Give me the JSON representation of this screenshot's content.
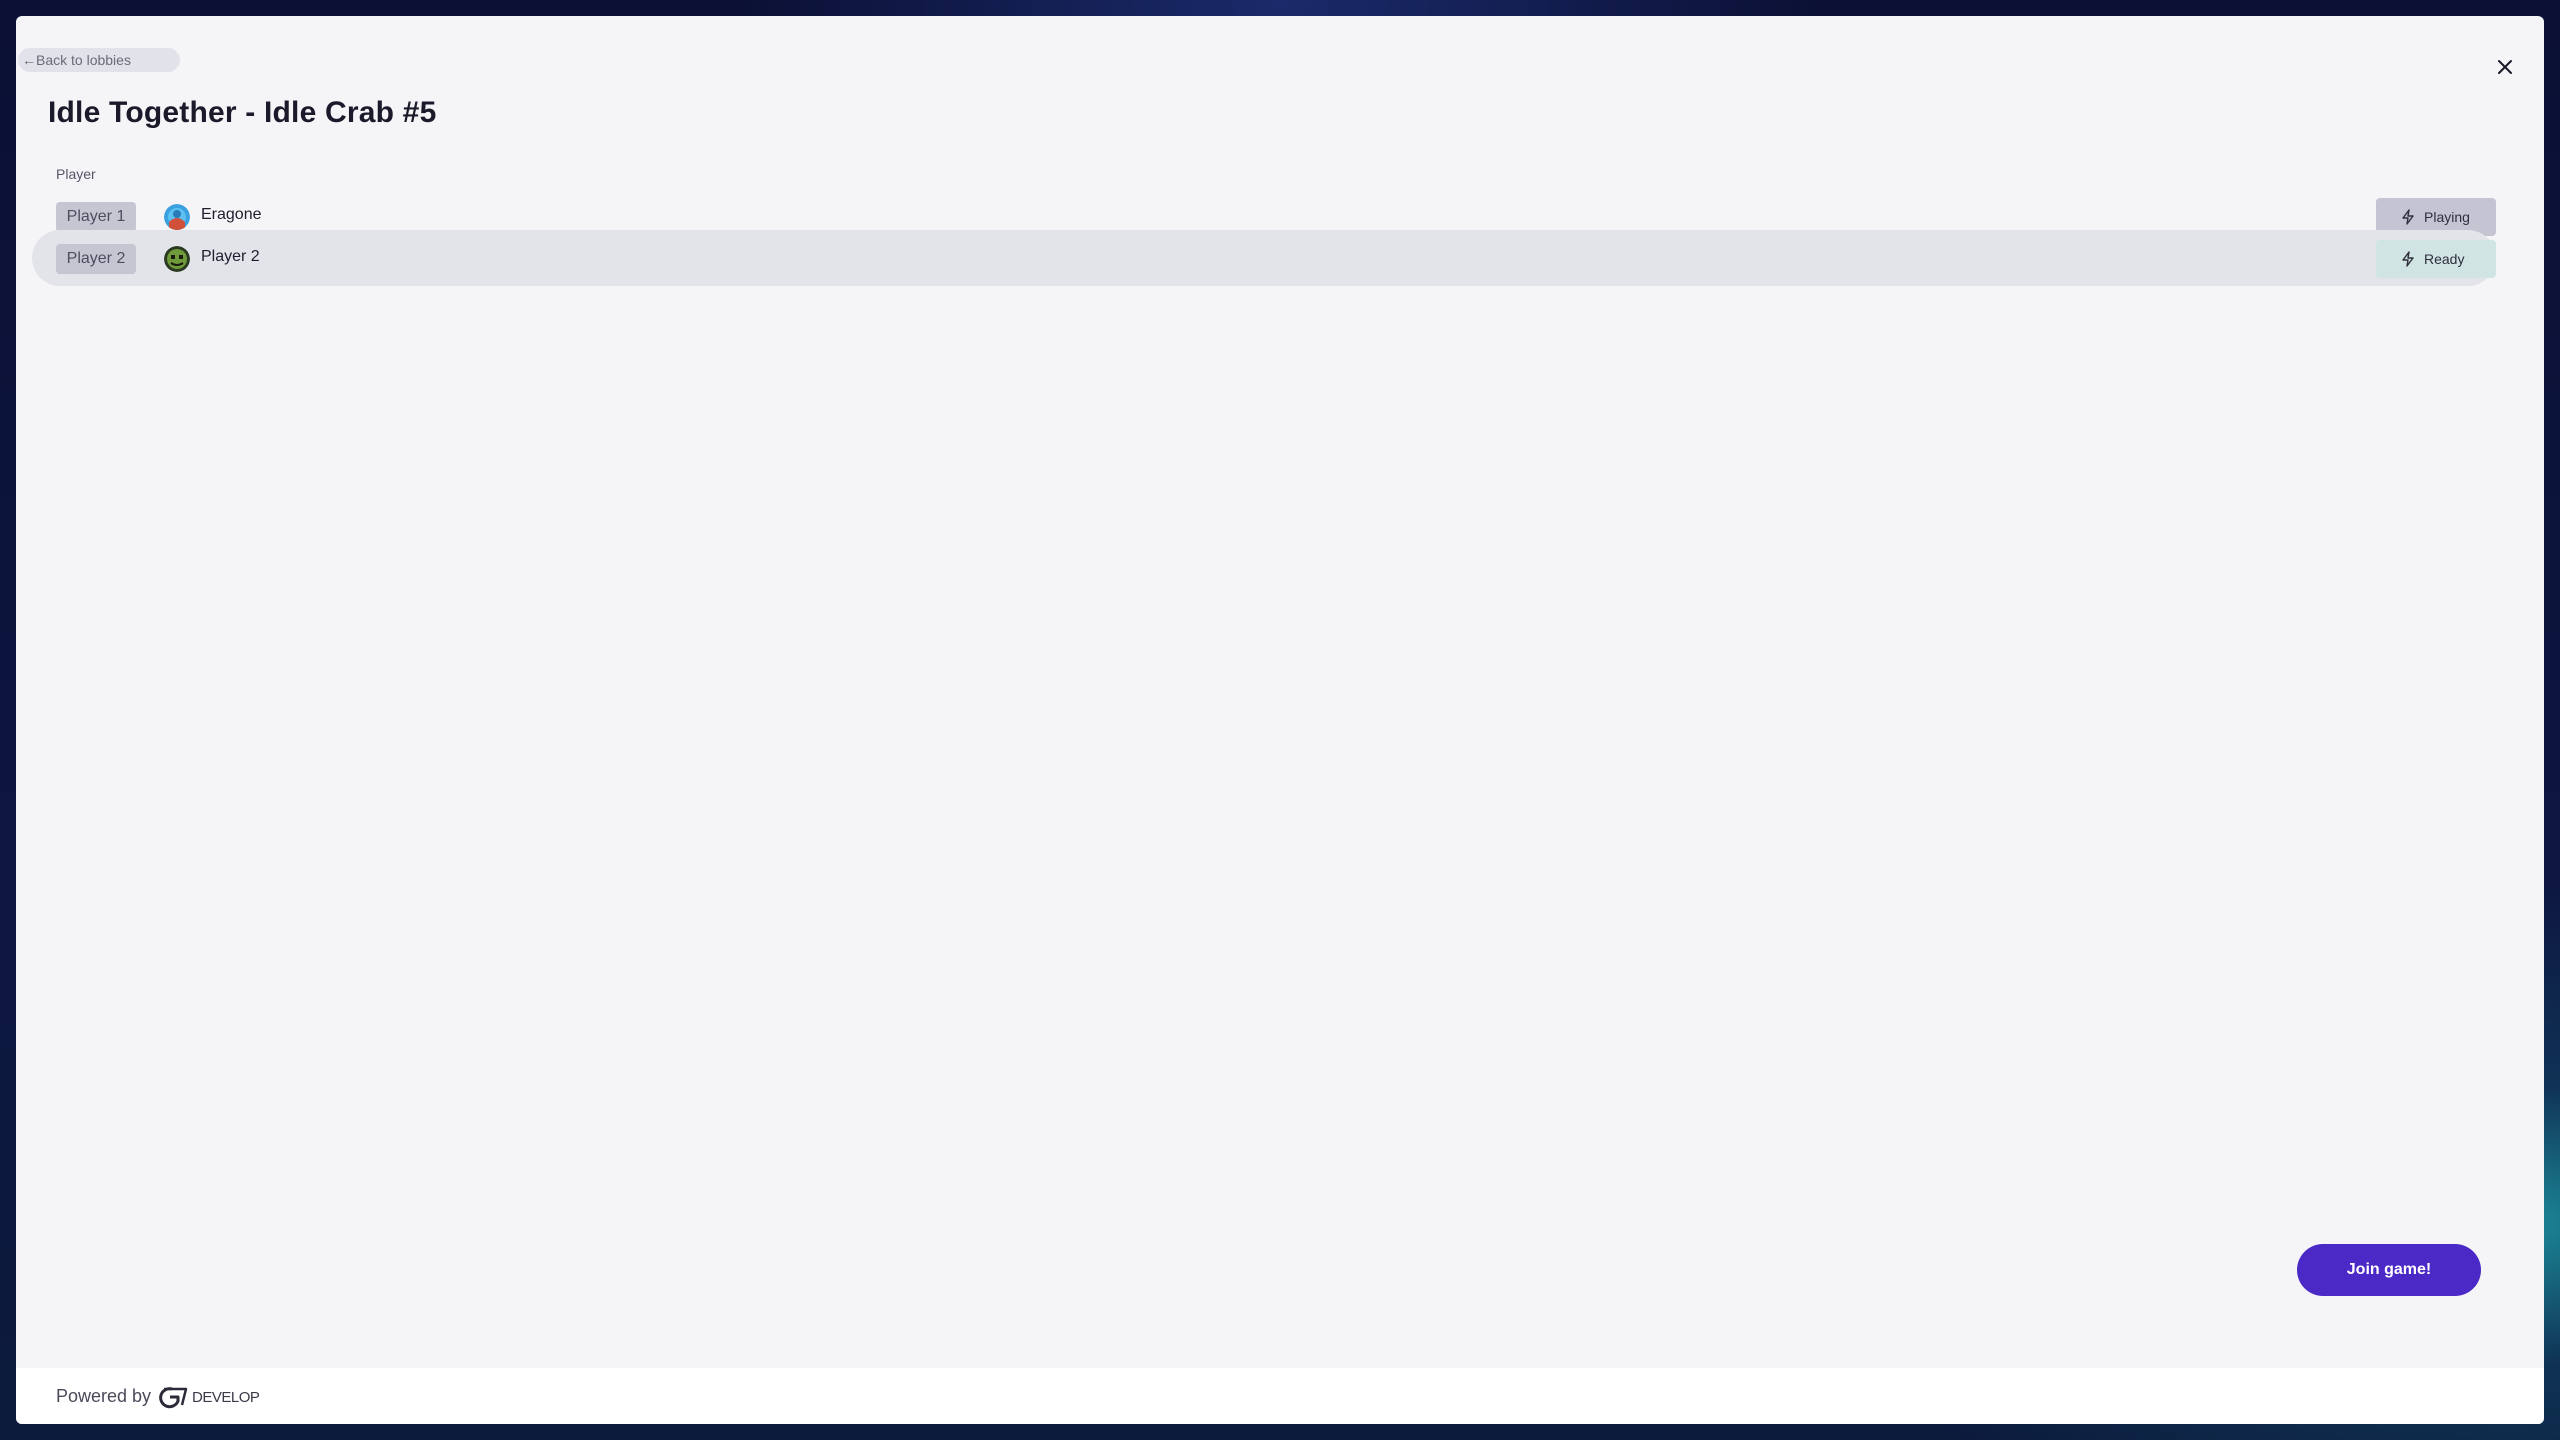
{
  "dialog": {
    "back_link_label": "Back to lobbies",
    "back_arrow": "←",
    "close_icon": "close-icon",
    "title": "Idle Together - Idle Crab #5",
    "column_header": "Player"
  },
  "players": [
    {
      "slot": "Player 1",
      "name": "Eragone",
      "status": "Playing",
      "status_icon": "bolt-icon",
      "avatar_color": "#3aa0e0"
    },
    {
      "slot": "Player 2",
      "name": "Player 2",
      "status": "Ready",
      "status_icon": "bolt-icon",
      "avatar_color": "#3c5a2c"
    }
  ],
  "actions": {
    "join_label": "Join game!"
  },
  "footer": {
    "powered_by": "Powered by",
    "brand": "DEVELOP"
  },
  "colors": {
    "accent": "#4b29c6",
    "playing_bg": "#c4c4d2",
    "ready_bg": "#cfe4e3"
  }
}
